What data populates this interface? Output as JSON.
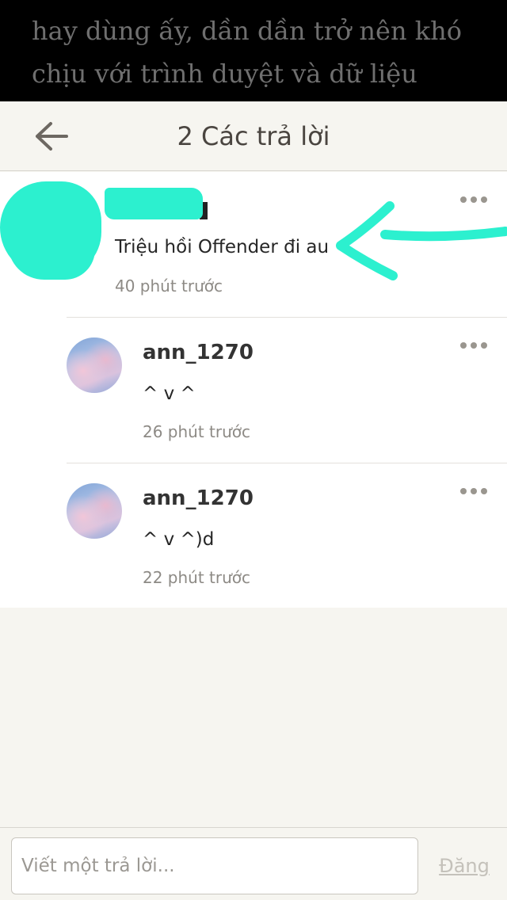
{
  "background_story": {
    "lines": [
      "hay dùng ấy, dần dần trở nên khó",
      "chịu với trình duyệt và dữ liệu"
    ]
  },
  "header": {
    "title": "2 Các trả lời",
    "back_icon": "arrow-left-icon"
  },
  "comments": [
    {
      "name": "",
      "text": "Triệu hồi Offender đi au",
      "time": "40 phút trước",
      "more_icon": "more-horizontal-icon"
    }
  ],
  "replies": [
    {
      "name": "ann_1270",
      "text": "^ v ^",
      "time": "26 phút trước",
      "more_icon": "more-horizontal-icon"
    },
    {
      "name": "ann_1270",
      "text": "^ v ^)d",
      "time": "22 phút trước",
      "more_icon": "more-horizontal-icon"
    }
  ],
  "compose": {
    "placeholder": "Viết một trả lời...",
    "value": "",
    "post_label": "Đăng"
  },
  "colors": {
    "annotation": "#2cf0cf",
    "background": "#f6f5f0",
    "muted_text": "#8d8a85"
  }
}
